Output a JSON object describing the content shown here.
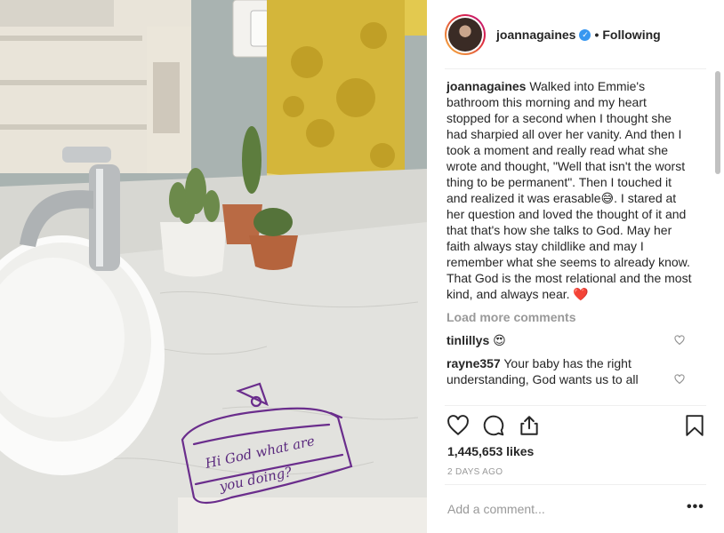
{
  "post": {
    "username": "joannagaines",
    "verified_icon": "verified-badge-icon",
    "separator": "•",
    "follow_status": "Following",
    "caption": "Walked into Emmie's bathroom this morning and my heart stopped for a second when I thought she had sharpied all over her vanity. And then I took a moment and really read what she wrote and thought, \"Well that isn't the worst thing to be permanent\". Then I touched it and realized it was erasable😅. I stared at her question and loved the thought of it and that that's how she talks to God. May her faith always stay childlike and may I remember what she seems to already know. That God is the most relational and the most kind, and always near. ❤️",
    "load_more": "Load more comments",
    "comments": [
      {
        "user": "tinlillys",
        "text": "😍"
      },
      {
        "user": "rayne357",
        "text": "Your baby has the right understanding, God wants us to all"
      }
    ],
    "likes": "1,445,653 likes",
    "date": "2 DAYS AGO",
    "add_comment_placeholder": "Add a comment...",
    "more_options": "•••"
  },
  "photo": {
    "note_text_line1": "Hi God what are",
    "note_text_line2": "you doing?"
  },
  "colors": {
    "accent_blue": "#3897f0",
    "text": "#262626",
    "muted": "#999999",
    "heart_red": "#ed4956"
  }
}
